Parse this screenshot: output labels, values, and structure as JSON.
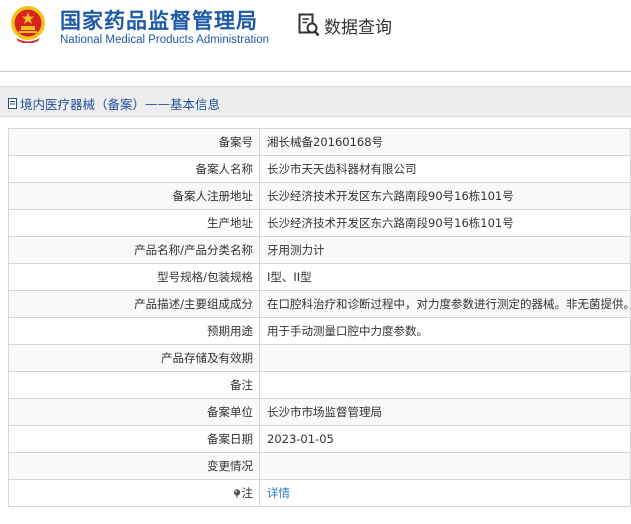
{
  "header": {
    "title_cn": "国家药品监督管理局",
    "title_en": "National Medical Products Administration",
    "search_link": "数据查询"
  },
  "section": {
    "breadcrumb": "境内医疗器械（备案）",
    "separator": "——",
    "title": "基本信息"
  },
  "rows": [
    {
      "label": "备案号",
      "value": "湘长械备20160168号"
    },
    {
      "label": "备案人名称",
      "value": "长沙市天天齿科器材有限公司"
    },
    {
      "label": "备案人注册地址",
      "value": "长沙经济技术开发区东六路南段90号16栋101号"
    },
    {
      "label": "生产地址",
      "value": "长沙经济技术开发区东六路南段90号16栋101号"
    },
    {
      "label": "产品名称/产品分类名称",
      "value": "牙用测力计"
    },
    {
      "label": "型号规格/包装规格",
      "value": "I型、II型"
    },
    {
      "label": "产品描述/主要组成成分",
      "value": "在口腔科治疗和诊断过程中，对力度参数进行测定的器械。非无菌提供。"
    },
    {
      "label": "预期用途",
      "value": "用于手动测量口腔中力度参数。"
    },
    {
      "label": "产品存储及有效期",
      "value": ""
    },
    {
      "label": "备注",
      "value": ""
    },
    {
      "label": "备案单位",
      "value": "长沙市市场监督管理局"
    },
    {
      "label": "备案日期",
      "value": "2023-01-05"
    },
    {
      "label": "变更情况",
      "value": ""
    },
    {
      "label": "注",
      "value": "详情"
    }
  ],
  "colors": {
    "brand_blue": "#1e5aa8",
    "link_blue": "#2a7ab8",
    "emblem_red": "#d8221e",
    "emblem_gold": "#f2c21a"
  }
}
